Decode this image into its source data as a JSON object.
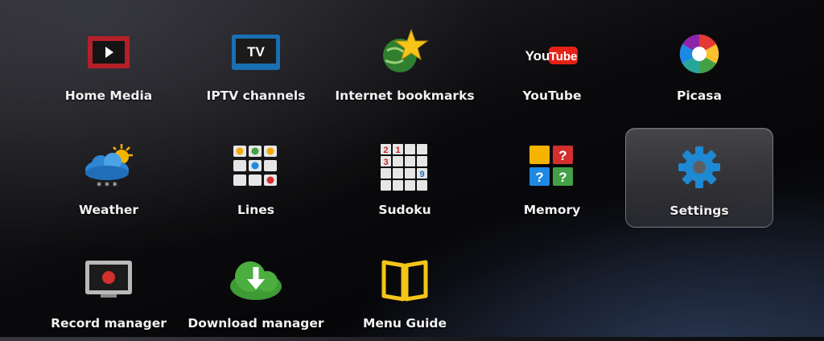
{
  "menu": {
    "items": [
      {
        "label": "Home Media",
        "icon": "home-media-icon"
      },
      {
        "label": "IPTV channels",
        "icon": "tv-icon",
        "icon_text": "TV"
      },
      {
        "label": "Internet bookmarks",
        "icon": "globe-star-icon"
      },
      {
        "label": "YouTube",
        "icon": "youtube-logo-icon",
        "logo_text_1": "You",
        "logo_text_2": "Tube"
      },
      {
        "label": "Picasa",
        "icon": "picasa-logo-icon"
      },
      {
        "label": "Weather",
        "icon": "weather-cloud-sun-icon"
      },
      {
        "label": "Lines",
        "icon": "lines-game-icon"
      },
      {
        "label": "Sudoku",
        "icon": "sudoku-grid-icon",
        "digits": [
          "2",
          "1",
          "3",
          "9"
        ]
      },
      {
        "label": "Memory",
        "icon": "memory-cards-icon",
        "symbols": [
          "?",
          "?",
          "?"
        ]
      },
      {
        "label": "Settings",
        "icon": "gear-icon",
        "selected": true
      },
      {
        "label": "Record manager",
        "icon": "record-icon"
      },
      {
        "label": "Download manager",
        "icon": "download-cloud-icon"
      },
      {
        "label": "Menu Guide",
        "icon": "book-icon"
      }
    ],
    "selected_label": "Settings"
  },
  "colors": {
    "selection_tile": "#5a5a5f",
    "label_text": "#f2f2f2",
    "settings_gear": "#1e88d2",
    "youtube_red": "#e62117"
  }
}
